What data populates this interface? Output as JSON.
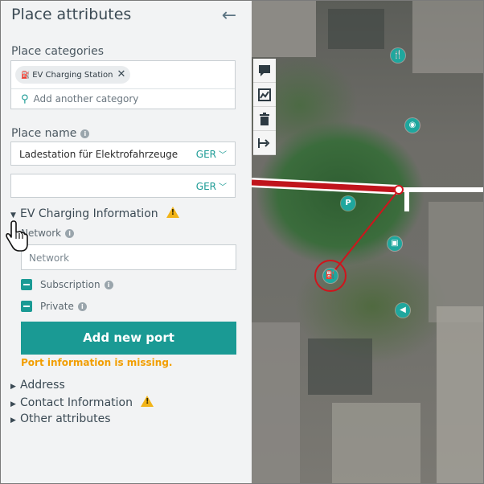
{
  "panel": {
    "title": "Place attributes",
    "back_icon": "arrow-left-icon",
    "categories_label": "Place categories",
    "category_chip": "EV Charging Station",
    "add_category_placeholder": "Add another category",
    "place_name_label": "Place name",
    "place_name_value": "Ladestation für Elektrofahrzeuge",
    "lang_1": "GER",
    "lang_2": "GER",
    "ev_section": "EV Charging Information",
    "network_label": "Network",
    "network_placeholder": "Network",
    "subscription_label": "Subscription",
    "private_label": "Private",
    "add_port_button": "Add new port",
    "missing_msg": "Port information is missing.",
    "address_section": "Address",
    "contact_section": "Contact Information",
    "other_section": "Other attributes"
  },
  "colors": {
    "accent": "#1a9a94",
    "warning": "#f2b418",
    "error_text": "#f29e00",
    "road_red": "#c0141c"
  },
  "map": {
    "tools": [
      "comment-icon",
      "chart-icon",
      "trash-icon",
      "route-arrow-icon"
    ],
    "poi_icons": [
      "restaurant-icon",
      "camera-icon",
      "parking-icon",
      "transit-icon",
      "ev-charging-icon",
      "speaker-icon"
    ]
  }
}
